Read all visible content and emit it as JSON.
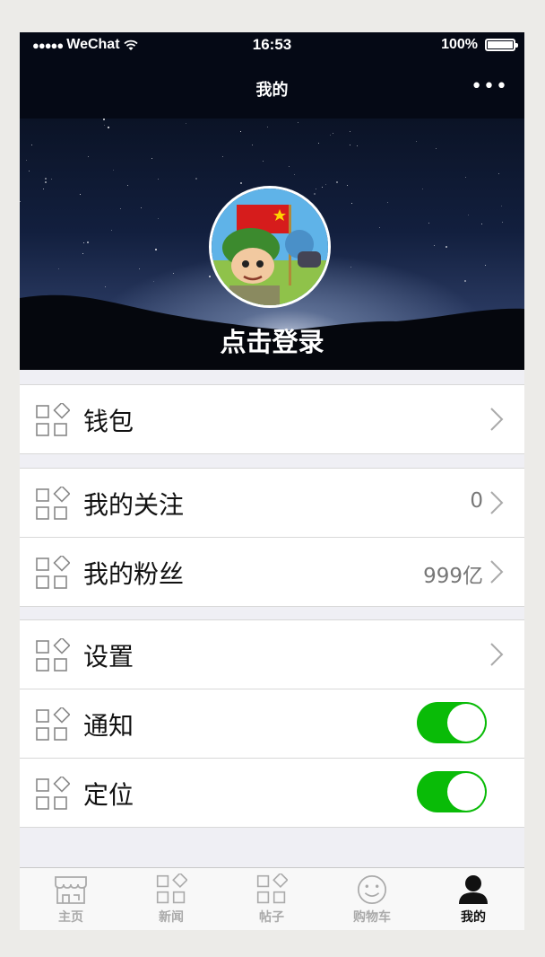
{
  "status_bar": {
    "signal": "●●●●●",
    "carrier": "WeChat",
    "time": "16:53",
    "battery": "100%"
  },
  "nav": {
    "title": "我的",
    "more": "•••"
  },
  "profile": {
    "login_text": "点击登录",
    "avatar_icon": "soldier-avatar"
  },
  "groups": [
    {
      "rows": [
        {
          "label": "钱包",
          "value": "",
          "control": "chevron"
        }
      ]
    },
    {
      "rows": [
        {
          "label": "我的关注",
          "value": "0",
          "control": "chevron"
        },
        {
          "label": "我的粉丝",
          "value": "999亿",
          "control": "chevron"
        }
      ]
    },
    {
      "rows": [
        {
          "label": "设置",
          "value": "",
          "control": "chevron"
        },
        {
          "label": "通知",
          "value": "",
          "control": "toggle",
          "on": true
        },
        {
          "label": "定位",
          "value": "",
          "control": "toggle",
          "on": true
        }
      ]
    }
  ],
  "tabs": [
    {
      "label": "主页",
      "icon": "store-icon",
      "active": false
    },
    {
      "label": "新闻",
      "icon": "grid-icon",
      "active": false
    },
    {
      "label": "帖子",
      "icon": "grid-icon",
      "active": false
    },
    {
      "label": "购物车",
      "icon": "smile-icon",
      "active": false
    },
    {
      "label": "我的",
      "icon": "user-icon",
      "active": true
    }
  ],
  "colors": {
    "toggle_on": "#09bb07",
    "bar_bg": "#050915",
    "tab_inactive": "#aaaaaa",
    "tab_active": "#111111"
  }
}
